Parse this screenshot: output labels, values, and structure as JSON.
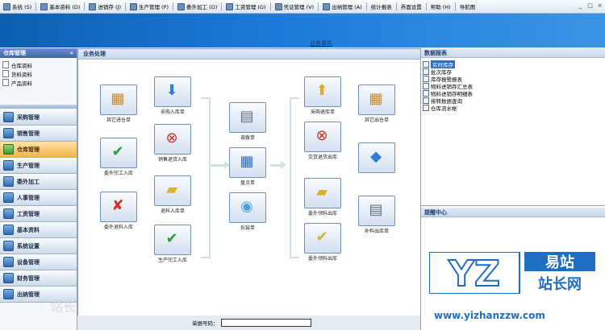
{
  "menubar": {
    "items": [
      "系统 (S)",
      "基本资料 (D)",
      "进销存 (J)",
      "生产管理 (P)",
      "委外加工 (O)",
      "工资管理 (G)",
      "凭证管理 (V)",
      "出纳管理 (A)",
      "统计报表",
      "界面设置",
      "帮助 (H)",
      "导航图"
    ],
    "window_controls": [
      "_",
      "□",
      "×"
    ]
  },
  "banner": {
    "title": "业务事件"
  },
  "left_panel": {
    "title": "仓库管理",
    "collapse_glyph": "«",
    "tree": [
      "仓库资料",
      "货料资料",
      "产品资料"
    ],
    "menu": [
      {
        "label": "采购管理",
        "active": false
      },
      {
        "label": "销售管理",
        "active": false
      },
      {
        "label": "仓库管理",
        "active": true
      },
      {
        "label": "生产管理",
        "active": false
      },
      {
        "label": "委外加工",
        "active": false
      },
      {
        "label": "人事管理",
        "active": false
      },
      {
        "label": "工资管理",
        "active": false
      },
      {
        "label": "基本资料",
        "active": false
      },
      {
        "label": "系统设置",
        "active": false
      },
      {
        "label": "设备管理",
        "active": false
      },
      {
        "label": "财务管理",
        "active": false
      },
      {
        "label": "出纳管理",
        "active": false
      }
    ]
  },
  "center": {
    "title": "业务处理",
    "flows": {
      "f1": "其它进仓单",
      "f2": "采购入库单",
      "f3": "委外完工入库",
      "f4": "销售退货入库",
      "f5": "委外退料入库",
      "f6": "退料入库单",
      "f7": "生产完工入库",
      "f8": "调拨单",
      "f9": "盘点单",
      "f10": "拆装单",
      "f11": "采购退库单",
      "f12": "其它出仓单",
      "f13": "交货退货出库",
      "f14": "委外领料出库",
      "f15": "补料出库单",
      "f16": "委外领料出库"
    }
  },
  "right_panel": {
    "reports_title": "数据报表",
    "reports": [
      "实时库存",
      "批次库存",
      "库存报警报表",
      "物料进销存汇总表",
      "物料进销存明细表",
      "排转数据查询",
      "仓库流水帐"
    ],
    "selected_index": 0,
    "reminder_title": "提醒中心"
  },
  "status_bar": {
    "label": "单据号码：",
    "field_value": ""
  },
  "watermark": {
    "logo_left": "YZ",
    "logo_right_top": "易站",
    "logo_right_bottom": "站长网",
    "url": "www.yizhanzzw.com",
    "left_text": "站长"
  },
  "colors": {
    "banner": "#1c7ad8",
    "active_menu": "#f7b44c",
    "selection": "#2f6cc0",
    "watermark": "#1e6fc2"
  }
}
